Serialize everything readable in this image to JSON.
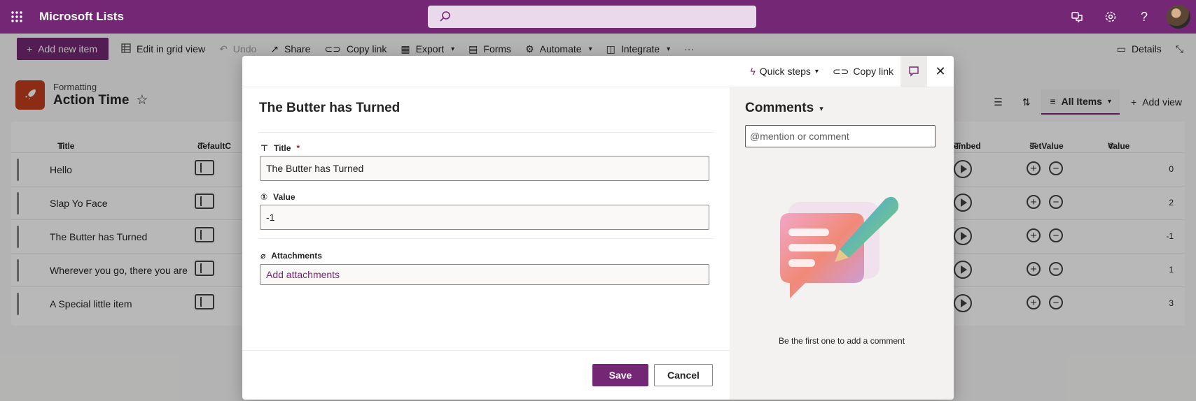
{
  "suite": {
    "app_name": "Microsoft Lists",
    "search_placeholder": ""
  },
  "commands": {
    "add_new_item": "Add new item",
    "edit_grid": "Edit in grid view",
    "undo": "Undo",
    "share": "Share",
    "copy_link": "Copy link",
    "export": "Export",
    "forms": "Forms",
    "automate": "Automate",
    "integrate": "Integrate",
    "details": "Details"
  },
  "list": {
    "breadcrumb": "Formatting",
    "title": "Action Time"
  },
  "views": {
    "all_items": "All Items",
    "add_view": "Add view"
  },
  "columns": {
    "title": "Title",
    "default": "defaultC",
    "embed": "embed",
    "setvalue": "setValue",
    "value": "Value"
  },
  "rows": [
    {
      "title": "Hello",
      "value": "0"
    },
    {
      "title": "Slap Yo Face",
      "value": "2"
    },
    {
      "title": "The Butter has Turned",
      "value": "-1"
    },
    {
      "title": "Wherever you go, there you are",
      "value": "1"
    },
    {
      "title": "A Special little item",
      "value": "3"
    }
  ],
  "dialog": {
    "quick_steps": "Quick steps",
    "copy_link": "Copy link",
    "heading": "The Butter has Turned",
    "title_label": "Title",
    "title_required": "*",
    "title_value": "The Butter has Turned",
    "value_label": "Value",
    "value_value": "-1",
    "attachments_label": "Attachments",
    "add_attachments": "Add attachments",
    "save": "Save",
    "cancel": "Cancel"
  },
  "comments": {
    "title": "Comments",
    "placeholder": "@mention or comment",
    "empty_text": "Be the first one to add a comment"
  },
  "colors": {
    "brand": "#742774",
    "list_icon": "#c43e1c"
  }
}
